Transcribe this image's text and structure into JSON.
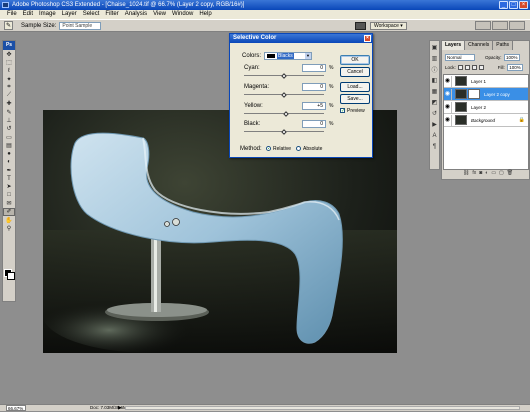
{
  "window": {
    "title": "Adobe Photoshop CS3 Extended - [Chaise_1024.tif @ 66.7% (Layer 2 copy, RGB/16#)]"
  },
  "menu": [
    "File",
    "Edit",
    "Image",
    "Layer",
    "Select",
    "Filter",
    "Analysis",
    "View",
    "Window",
    "Help"
  ],
  "options_bar": {
    "sample_size_label": "Sample Size:",
    "sample_size_value": "Point Sample",
    "workspace_label": "Workspace ▾"
  },
  "dialog": {
    "title": "Selective Color",
    "colors_label": "Colors:",
    "colors_value": "Blacks",
    "fields": [
      {
        "label": "Cyan:",
        "value": "0",
        "unit": "%",
        "level": 0.5
      },
      {
        "label": "Magenta:",
        "value": "0",
        "unit": "%",
        "level": 0.5
      },
      {
        "label": "Yellow:",
        "value": "+5",
        "unit": "%",
        "level": 0.525
      },
      {
        "label": "Black:",
        "value": "0",
        "unit": "%",
        "level": 0.5
      }
    ],
    "buttons": {
      "ok": "OK",
      "cancel": "Cancel",
      "load": "Load...",
      "save": "Save..."
    },
    "preview_label": "Preview",
    "preview_checked": true,
    "method_label": "Method:",
    "method_options": [
      "Relative",
      "Absolute"
    ],
    "method_selected": "Relative"
  },
  "layers_panel": {
    "tabs": [
      "Layers",
      "Channels",
      "Paths"
    ],
    "active_tab": "Layers",
    "blend_mode": "Normal",
    "opacity_label": "Opacity:",
    "opacity_value": "100%",
    "lock_label": "Lock:",
    "fill_label": "Fill:",
    "fill_value": "100%",
    "layers": [
      {
        "name": "Layer 1",
        "selected": false,
        "visible": true
      },
      {
        "name": "Layer 2 copy",
        "selected": true,
        "visible": true
      },
      {
        "name": "Layer 2",
        "selected": false,
        "visible": true
      },
      {
        "name": "Background",
        "selected": false,
        "visible": true,
        "locked": true
      }
    ]
  },
  "status_bar": {
    "zoom": "66.67%",
    "doc_info": "Doc: 7.03M/39.6M"
  }
}
